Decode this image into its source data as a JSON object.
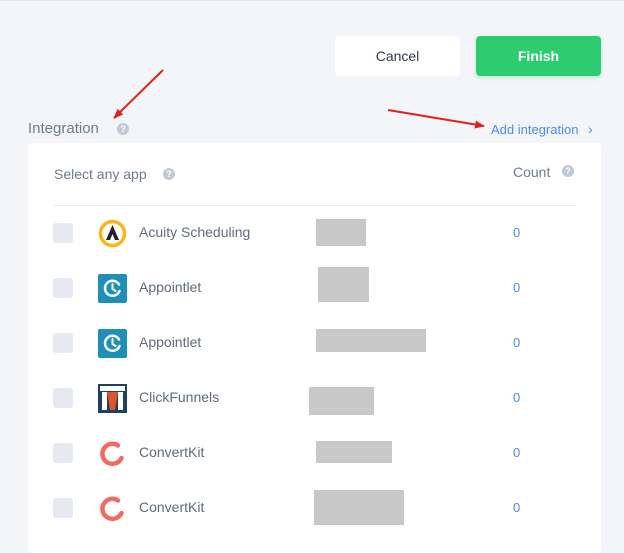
{
  "actions": {
    "cancel_label": "Cancel",
    "finish_label": "Finish"
  },
  "section": {
    "title": "Integration",
    "add_link": "Add integration",
    "add_chevron": "›"
  },
  "table": {
    "select_label": "Select any app",
    "count_label": "Count",
    "rows": [
      {
        "name": "Acuity Scheduling",
        "count": "0",
        "logo": "acuity-logo"
      },
      {
        "name": "Appointlet",
        "count": "0",
        "logo": "appointlet-logo"
      },
      {
        "name": "Appointlet",
        "count": "0",
        "logo": "appointlet-logo"
      },
      {
        "name": "ClickFunnels",
        "count": "0",
        "logo": "clickfunnels-logo"
      },
      {
        "name": "ConvertKit",
        "count": "0",
        "logo": "convertkit-logo"
      },
      {
        "name": "ConvertKit",
        "count": "0",
        "logo": "convertkit-logo"
      }
    ]
  },
  "help_glyph": "?",
  "colors": {
    "accent_green": "#2ecc71",
    "link_blue": "#4a8cf0",
    "annotation_red": "#e0201b"
  }
}
